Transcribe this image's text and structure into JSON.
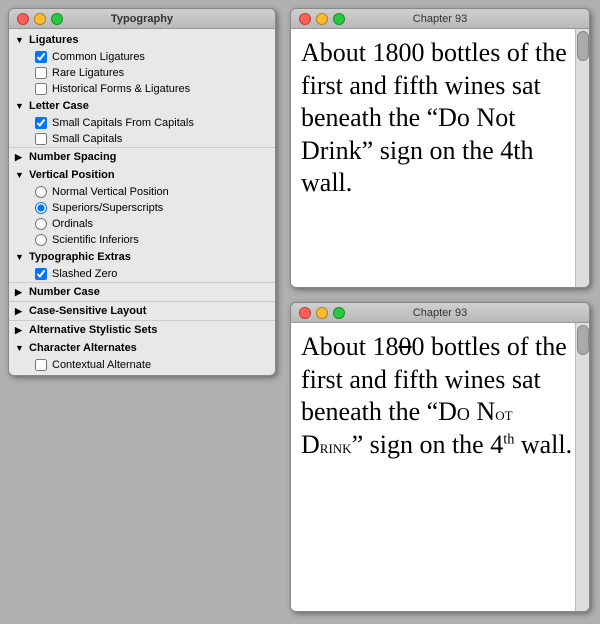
{
  "typography_panel": {
    "title": "Typography",
    "sections": {
      "ligatures": {
        "label": "Ligatures",
        "expanded": true,
        "items": [
          {
            "type": "checkbox",
            "label": "Common Ligatures",
            "checked": true
          },
          {
            "type": "checkbox",
            "label": "Rare Ligatures",
            "checked": false
          },
          {
            "type": "checkbox",
            "label": "Historical Forms & Ligatures",
            "checked": false
          }
        ]
      },
      "letter_case": {
        "label": "Letter Case",
        "expanded": true,
        "items": [
          {
            "type": "checkbox",
            "label": "Small Capitals From Capitals",
            "checked": true
          },
          {
            "type": "checkbox",
            "label": "Small Capitals",
            "checked": false
          }
        ]
      },
      "number_spacing": {
        "label": "Number Spacing",
        "expanded": false
      },
      "vertical_position": {
        "label": "Vertical Position",
        "expanded": true,
        "items": [
          {
            "type": "radio",
            "label": "Normal Vertical Position",
            "checked": false
          },
          {
            "type": "radio",
            "label": "Superiors/Superscripts",
            "checked": true
          },
          {
            "type": "radio",
            "label": "Ordinals",
            "checked": false
          },
          {
            "type": "radio",
            "label": "Scientific Inferiors",
            "checked": false
          }
        ]
      },
      "typographic_extras": {
        "label": "Typographic Extras",
        "expanded": true,
        "items": [
          {
            "type": "checkbox",
            "label": "Slashed Zero",
            "checked": true
          }
        ]
      },
      "number_case": {
        "label": "Number Case",
        "expanded": false
      },
      "case_sensitive_layout": {
        "label": "Case-Sensitive Layout",
        "expanded": false
      },
      "alternative_stylistic_sets": {
        "label": "Alternative Stylistic Sets",
        "expanded": false
      },
      "character_alternates": {
        "label": "Character Alternates",
        "expanded": true,
        "items": [
          {
            "type": "checkbox",
            "label": "Contextual Alternate",
            "checked": false
          }
        ]
      }
    }
  },
  "preview_1": {
    "title": "Chapter 93",
    "text": "About 1800 bottles of the first and fifth wines sat beneath the “Do Not Drink” sign on the 4th wall."
  },
  "preview_2": {
    "title": "Chapter 93",
    "text_line1": "About 18",
    "slashed_zero": "0",
    "text_line2": "0 bottles of the first and fifth wines sat beneath the “Do Not Drink” sign on the 4",
    "superscript": "th",
    "text_line3": " wall."
  },
  "buttons": {
    "close": "close",
    "minimize": "minimize",
    "maximize": "maximize"
  }
}
